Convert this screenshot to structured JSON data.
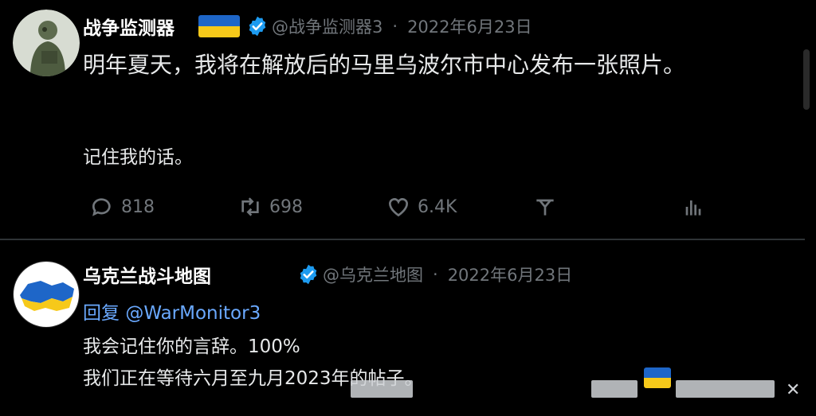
{
  "tweet1": {
    "name": "战争监测器",
    "handle": "@战争监测器3",
    "separator": "·",
    "date": "2022年6月23日",
    "line1": "明年夏天，我将在解放后的马里乌波尔市中心发布一张照片。",
    "line2": "记住我的话。",
    "stats": {
      "replies": "818",
      "retweets": "698",
      "likes": "6.4K"
    },
    "icons": [
      "reply-icon",
      "retweet-icon",
      "like-icon",
      "share-icon",
      "analytics-icon"
    ]
  },
  "tweet2": {
    "name": "乌克兰战斗地图",
    "handle": "@乌克兰地图",
    "separator": "·",
    "date": "2022年6月23日",
    "reply_prefix": "回复",
    "reply_handle": "@WarMonitor3",
    "line1": "我会记住你的言辞。100%",
    "line2": "我们正在等待六月至九月2023年的帖子。"
  },
  "colors": {
    "background": "#000000",
    "text": "#e7e9ea",
    "muted": "#71767b",
    "verified": "#1d9bf0",
    "link": "#6aa9ff",
    "flag_blue": "#1e66c8",
    "flag_yellow": "#f6c91a"
  }
}
